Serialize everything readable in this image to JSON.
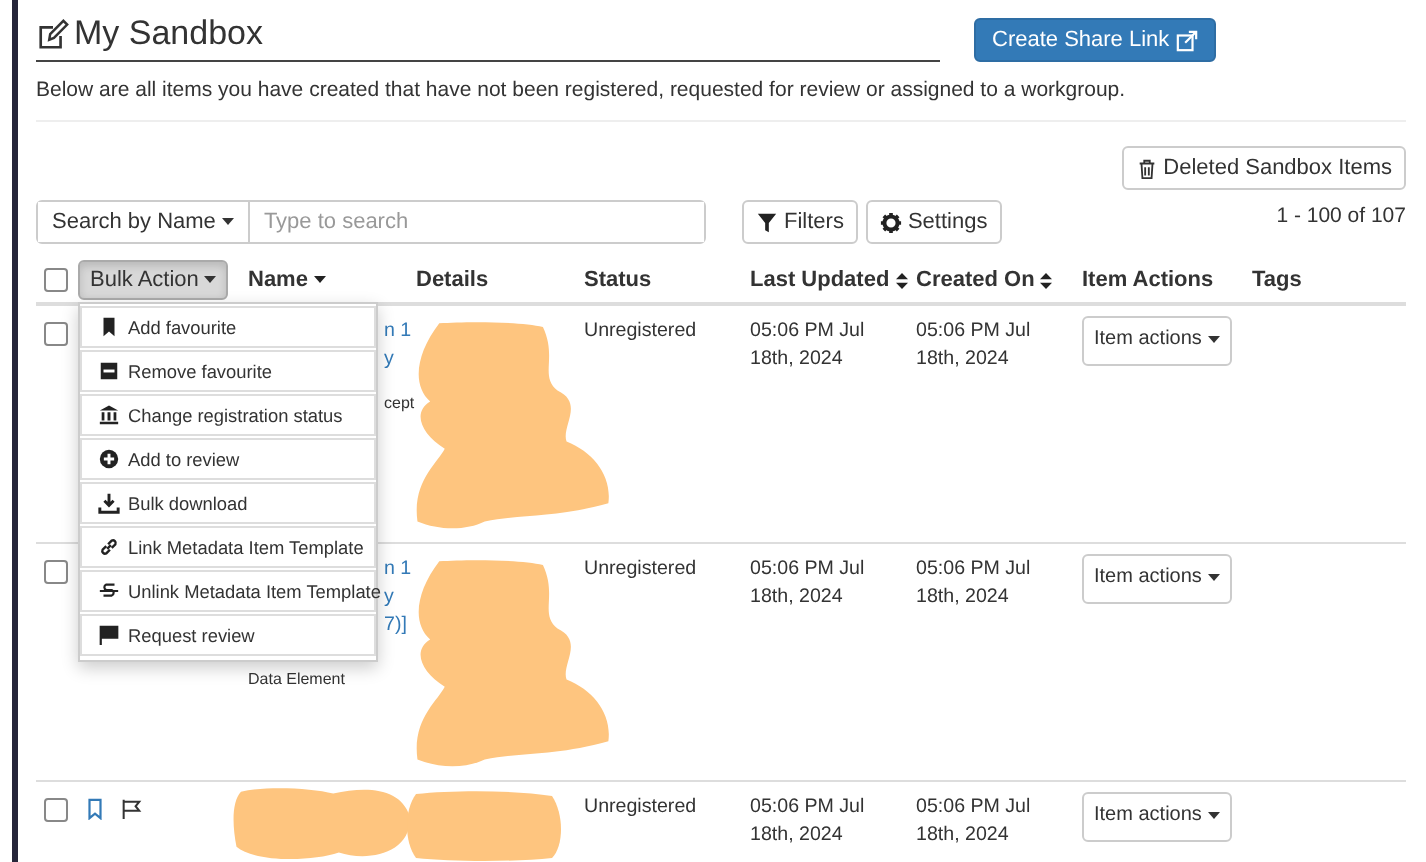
{
  "title": "My Sandbox",
  "share_button": "Create Share Link",
  "description": "Below are all items you have created that have not been registered, requested for review or assigned to a workgroup.",
  "deleted_button": "Deleted Sandbox Items",
  "search": {
    "mode": "Search by Name",
    "placeholder": "Type to search"
  },
  "filters_button": "Filters",
  "settings_button": "Settings",
  "pagination": "1 - 100 of 107",
  "table": {
    "select_all_checked": false,
    "bulk_action": "Bulk Action",
    "columns": [
      {
        "label": "Name",
        "dropdown": true
      },
      {
        "label": "Details"
      },
      {
        "label": "Status"
      },
      {
        "label": "Last Updated",
        "sortable": true
      },
      {
        "label": "Created On",
        "sortable": true
      },
      {
        "label": "Item Actions"
      },
      {
        "label": "Tags"
      }
    ],
    "rows": [
      {
        "checked": false,
        "name_parts": [
          {
            "text": "n 1",
            "kind": "link"
          },
          {
            "text": "y",
            "kind": "link"
          },
          {
            "text": "cept",
            "kind": "fragment"
          }
        ],
        "details_redacted": true,
        "name_redacted": false,
        "status": "Unregistered",
        "last_updated": "05:06 PM Jul 18th, 2024",
        "created_on": "05:06 PM Jul 18th, 2024",
        "action": "Item actions"
      },
      {
        "checked": false,
        "name_parts": [
          {
            "text": "n 1",
            "kind": "link"
          },
          {
            "text": "y",
            "kind": "link"
          },
          {
            "text": "7)]",
            "kind": "link"
          },
          {
            "text": "Data Element",
            "kind": "type"
          }
        ],
        "details_redacted": true,
        "name_redacted": false,
        "status": "Unregistered",
        "last_updated": "05:06 PM Jul 18th, 2024",
        "created_on": "05:06 PM Jul 18th, 2024",
        "action": "Item actions"
      },
      {
        "checked": false,
        "marks": {
          "favourite": false,
          "flagged": false
        },
        "name_parts": [],
        "details_redacted": true,
        "name_redacted": true,
        "status": "Unregistered",
        "last_updated": "05:06 PM Jul 18th, 2024",
        "created_on": "05:06 PM Jul 18th, 2024",
        "action": "Item actions"
      }
    ]
  },
  "bulk_menu": {
    "open": true,
    "items": [
      {
        "kind": "favourite",
        "label": "Add favourite"
      },
      {
        "kind": "unfavourite",
        "label": "Remove favourite"
      },
      {
        "kind": "status",
        "label": "Change registration status"
      },
      {
        "kind": "review",
        "label": "Add to review"
      },
      {
        "kind": "download",
        "label": "Bulk download"
      },
      {
        "kind": "link",
        "label": "Link Metadata Item Template"
      },
      {
        "kind": "unlink",
        "label": "Unlink Metadata Item Template"
      },
      {
        "kind": "request",
        "label": "Request review"
      }
    ]
  }
}
